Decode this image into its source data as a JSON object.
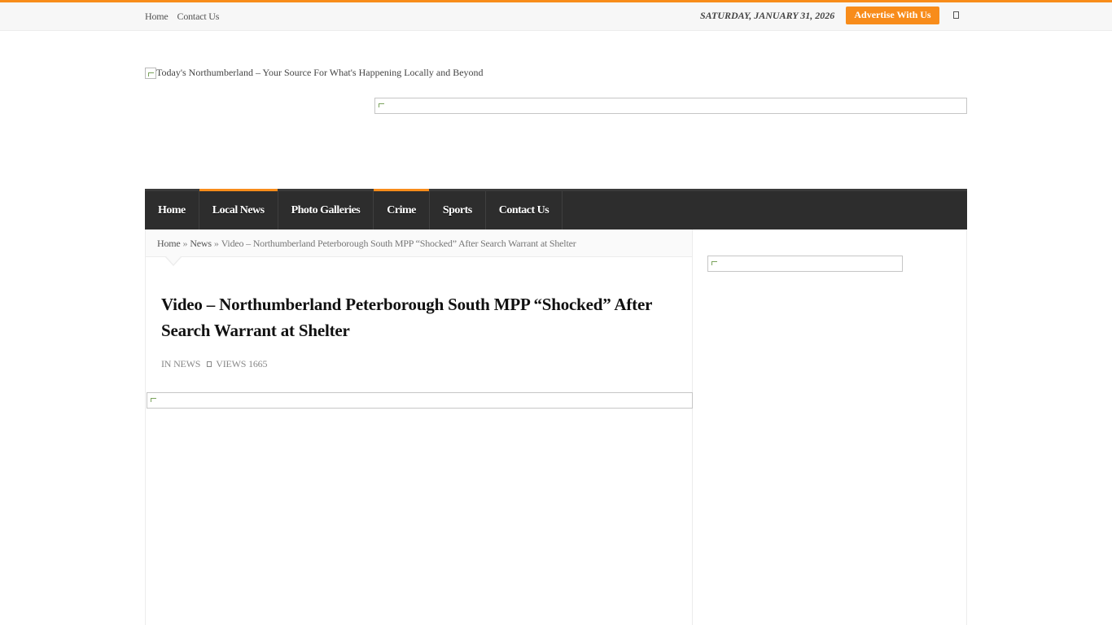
{
  "topbar": {
    "nav": [
      "Home",
      "Contact Us"
    ],
    "date": "SATURDAY, JANUARY 31, 2026",
    "advertise_label": "Advertise With Us"
  },
  "logo": {
    "alt": "Today's Northumberland – Your Source For What's Happening Locally and Beyond"
  },
  "mainnav": {
    "items": [
      {
        "label": "Home",
        "active": false
      },
      {
        "label": "Local News",
        "active": true
      },
      {
        "label": "Photo Galleries",
        "active": false
      },
      {
        "label": "Crime",
        "active": true
      },
      {
        "label": "Sports",
        "active": false
      },
      {
        "label": "Contact Us",
        "active": false
      }
    ]
  },
  "breadcrumb": {
    "home": "Home",
    "sep": "»",
    "section": "News",
    "current": "Video – Northumberland Peterborough South MPP “Shocked” After Search Warrant at Shelter"
  },
  "article": {
    "title": "Video – Northumberland Peterborough South MPP “Shocked” After Search Warrant at Shelter",
    "category_prefix": "IN",
    "category": "NEWS",
    "views_label": "VIEWS 1665"
  },
  "colors": {
    "accent": "#f88c1a",
    "nav_bg": "#2d2d2d"
  }
}
